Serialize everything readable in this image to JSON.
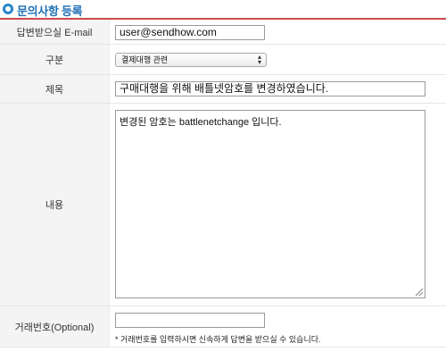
{
  "header": {
    "title": "문의사항 등록",
    "icon": "circle-bullet-icon",
    "accent_color": "#1f6fb5",
    "line_color": "#cc4b4b"
  },
  "form": {
    "email": {
      "label": "답변받으실 E-mail",
      "value": "user@sendhow.com"
    },
    "category": {
      "label": "구분",
      "selected": "결제대행 관련"
    },
    "subject": {
      "label": "제목",
      "value": "구매대행을 위해 배틀넷암호를 변경하였습니다."
    },
    "content": {
      "label": "내용",
      "value": "변경된 암호는 battlenetchange 입니다."
    },
    "order_number": {
      "label": "거래번호(Optional)",
      "value": "",
      "note": "* 거래번호를 입력하시면 신속하게 답변을 받으실 수 있습니다."
    }
  }
}
